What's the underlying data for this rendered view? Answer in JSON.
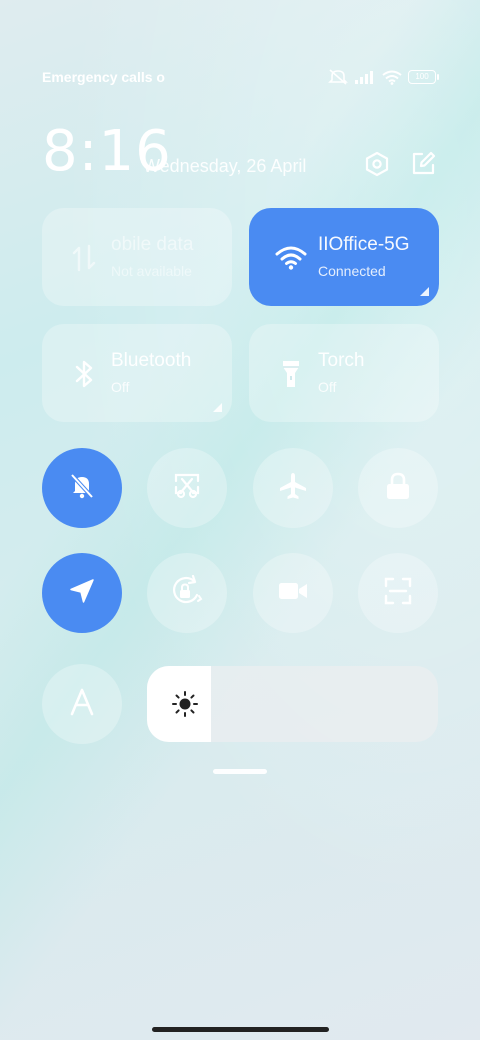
{
  "status_bar": {
    "carrier_text": "Emergency calls o",
    "battery_level": "100"
  },
  "header": {
    "time": "8:16",
    "date": "Wednesday, 26 April"
  },
  "tiles": {
    "mobile_data": {
      "title": "obile data",
      "subtitle": "Not available"
    },
    "wifi": {
      "title": "IIOffice-5G",
      "subtitle": "Connected"
    },
    "bluetooth": {
      "title": "Bluetooth",
      "subtitle": "Off"
    },
    "torch": {
      "title": "Torch",
      "subtitle": "Off"
    }
  },
  "brightness": {
    "level": 0.22
  },
  "colors": {
    "accent": "#4a8bf2",
    "tile_inactive": "rgba(255,255,255,0.28)"
  },
  "icons": {
    "mute": "bell-off-icon",
    "screenshot": "scissors-icon",
    "airplane": "airplane-icon",
    "lock": "lock-icon",
    "location": "location-arrow-icon",
    "rotation": "rotation-lock-icon",
    "video": "video-camera-icon",
    "scan": "scan-icon",
    "auto_text": "letter-a-icon",
    "brightness": "sun-icon"
  }
}
